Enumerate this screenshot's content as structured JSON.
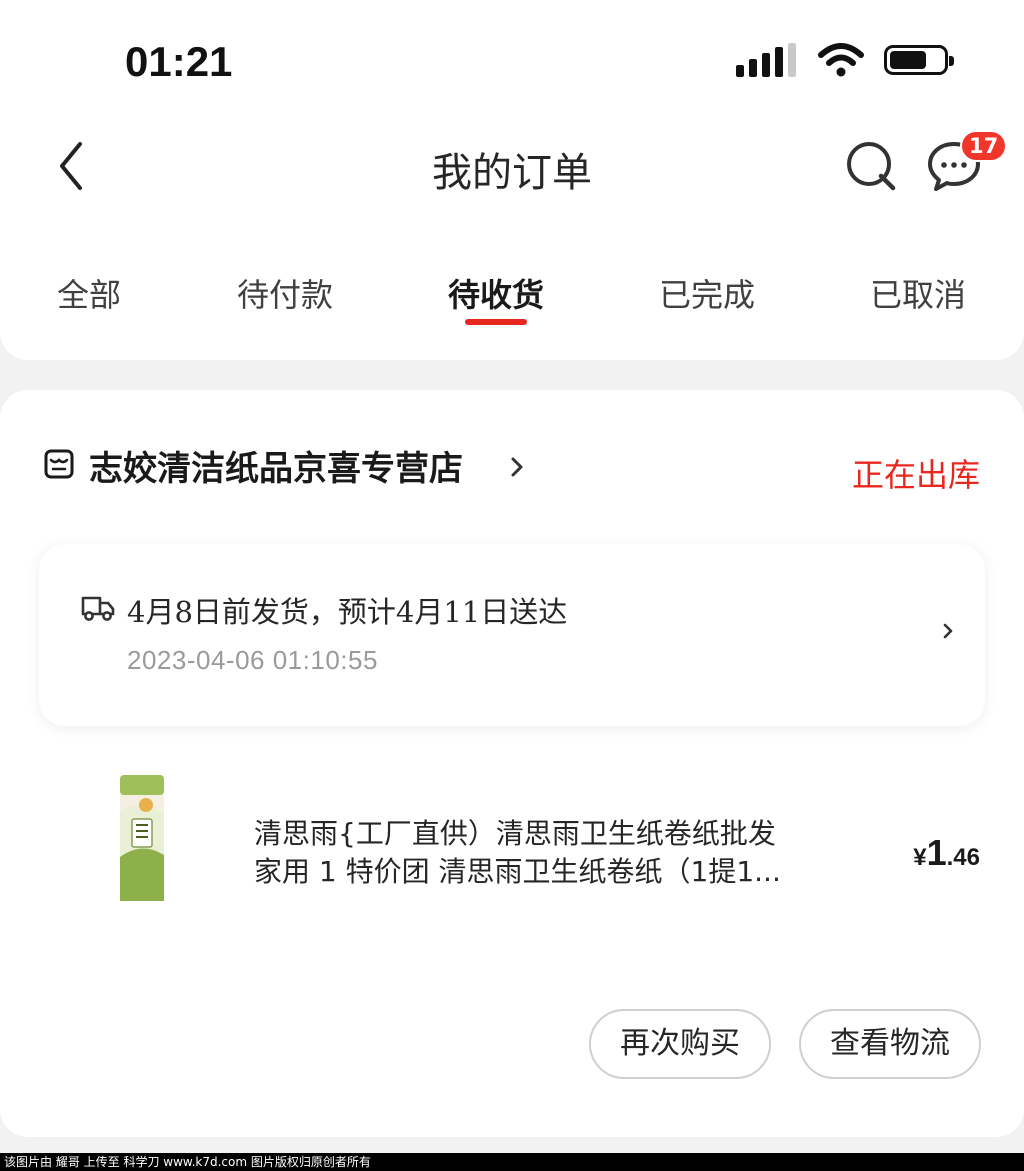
{
  "status_bar": {
    "time": "01:21"
  },
  "nav": {
    "title": "我的订单",
    "message_badge": "17"
  },
  "tabs": [
    {
      "label": "全部",
      "active": false
    },
    {
      "label": "待付款",
      "active": false
    },
    {
      "label": "待收货",
      "active": true
    },
    {
      "label": "已完成",
      "active": false
    },
    {
      "label": "已取消",
      "active": false
    }
  ],
  "order": {
    "store_name": "志姣清洁纸品京喜专营店",
    "status": "正在出库",
    "shipping": {
      "text": "4月8日前发货，预计4月11日送达",
      "time": "2023-04-06 01:10:55"
    },
    "product": {
      "title_line1": "清思雨{工厂直供）清思雨卫生纸卷纸批发",
      "title_line2": "家用  1  特价团 清思雨卫生纸卷纸（1提1...",
      "price_symbol": "¥",
      "price_int": "1",
      "price_dec": ".46"
    },
    "buttons": {
      "rebuy": "再次购买",
      "logistics": "查看物流"
    }
  },
  "watermark": "该图片由 耀哥 上传至 科学刀 www.k7d.com 图片版权归原创者所有",
  "colors": {
    "accent": "#e8271f",
    "badge": "#f0352a",
    "background": "#f2f2f2"
  }
}
